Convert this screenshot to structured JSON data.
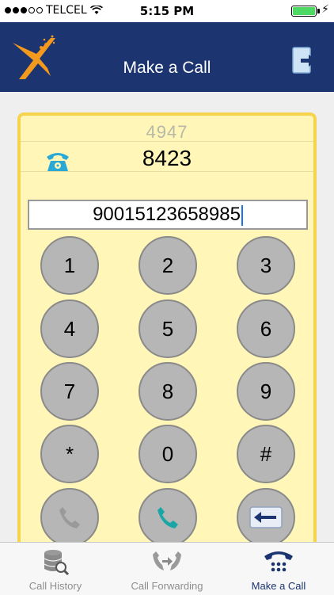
{
  "status_bar": {
    "carrier": "TELCEL",
    "time": "5:15 PM"
  },
  "header": {
    "title": "Make a Call"
  },
  "picker": {
    "prev_value": "4947",
    "selected_value": "8423"
  },
  "number_field": {
    "value": "90015123658985"
  },
  "keypad": {
    "keys": [
      "1",
      "2",
      "3",
      "4",
      "5",
      "6",
      "7",
      "8",
      "9",
      "*",
      "0",
      "#"
    ]
  },
  "tabs": [
    {
      "label": "Call History"
    },
    {
      "label": "Call Forwarding"
    },
    {
      "label": "Make a Call"
    }
  ],
  "colors": {
    "header_bg": "#1c3470",
    "panel_bg": "#fff6b8",
    "panel_border": "#f5d34c",
    "call_icon": "#1aa6a6",
    "logo_orange": "#f39a1e"
  }
}
